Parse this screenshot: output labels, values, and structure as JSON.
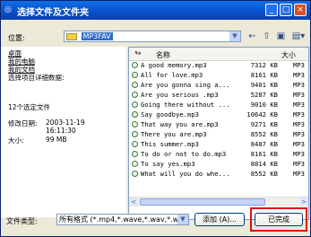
{
  "window": {
    "title": "选择文件及文件夹",
    "controls": {
      "minimize": "_",
      "maximize": "□",
      "close": "×"
    }
  },
  "location": {
    "label": "位置:",
    "value": "MP3FAV",
    "dropdown_arrow": "▼"
  },
  "toolbar": {
    "back": "←",
    "up": "⇧",
    "new_folder": "▣",
    "view": "▤▾"
  },
  "sidebar": {
    "links": [
      "桌面",
      "我的电脑",
      "我的文档",
      "选择项目详细数据:"
    ],
    "selection_count": "12个选定文件",
    "modified_label": "修改日期:",
    "modified_date": "2003-11-19",
    "modified_time": "16:11:30",
    "size_label": "大小:",
    "size_value": "99 MB"
  },
  "file_list": {
    "header_name": "名称",
    "header_size": "大小",
    "files": [
      {
        "name": "A good memory.mp3",
        "size": "7312 KB",
        "type": "MP3"
      },
      {
        "name": "All for love.mp3",
        "size": "8161 KB",
        "type": "MP3"
      },
      {
        "name": "Are you gonna sing a...",
        "size": "9401 KB",
        "type": "MP3"
      },
      {
        "name": "Are you serious .mp3",
        "size": "5287 KB",
        "type": "MP3"
      },
      {
        "name": "Going there without ...",
        "size": "9010 KB",
        "type": "MP3"
      },
      {
        "name": "Say goodbye.mp3",
        "size": "10642 KB",
        "type": "MP3"
      },
      {
        "name": "That way you are.mp3",
        "size": "9271 KB",
        "type": "MP3"
      },
      {
        "name": "There you are.mp3",
        "size": "8552 KB",
        "type": "MP3"
      },
      {
        "name": "This summer.mp3",
        "size": "8487 KB",
        "type": "MP3"
      },
      {
        "name": "To do or not to do.mp3",
        "size": "8161 KB",
        "type": "MP3"
      },
      {
        "name": "To say yes.mp3",
        "size": "8814 KB",
        "type": "MP3"
      },
      {
        "name": "What will you do whe...",
        "size": "8552 KB",
        "type": "MP3"
      }
    ],
    "scroll_left": "<",
    "scroll_right": ">"
  },
  "footer": {
    "file_type_label": "文件类型:",
    "file_type_value": "所有格式 (*.mp4,*.wave,*.wav,*.wav",
    "add_button": "添加 (A)...",
    "done_button": "已完成"
  },
  "colors": {
    "title_bar": "#0a4fc8",
    "highlight_box": "#e01010"
  }
}
